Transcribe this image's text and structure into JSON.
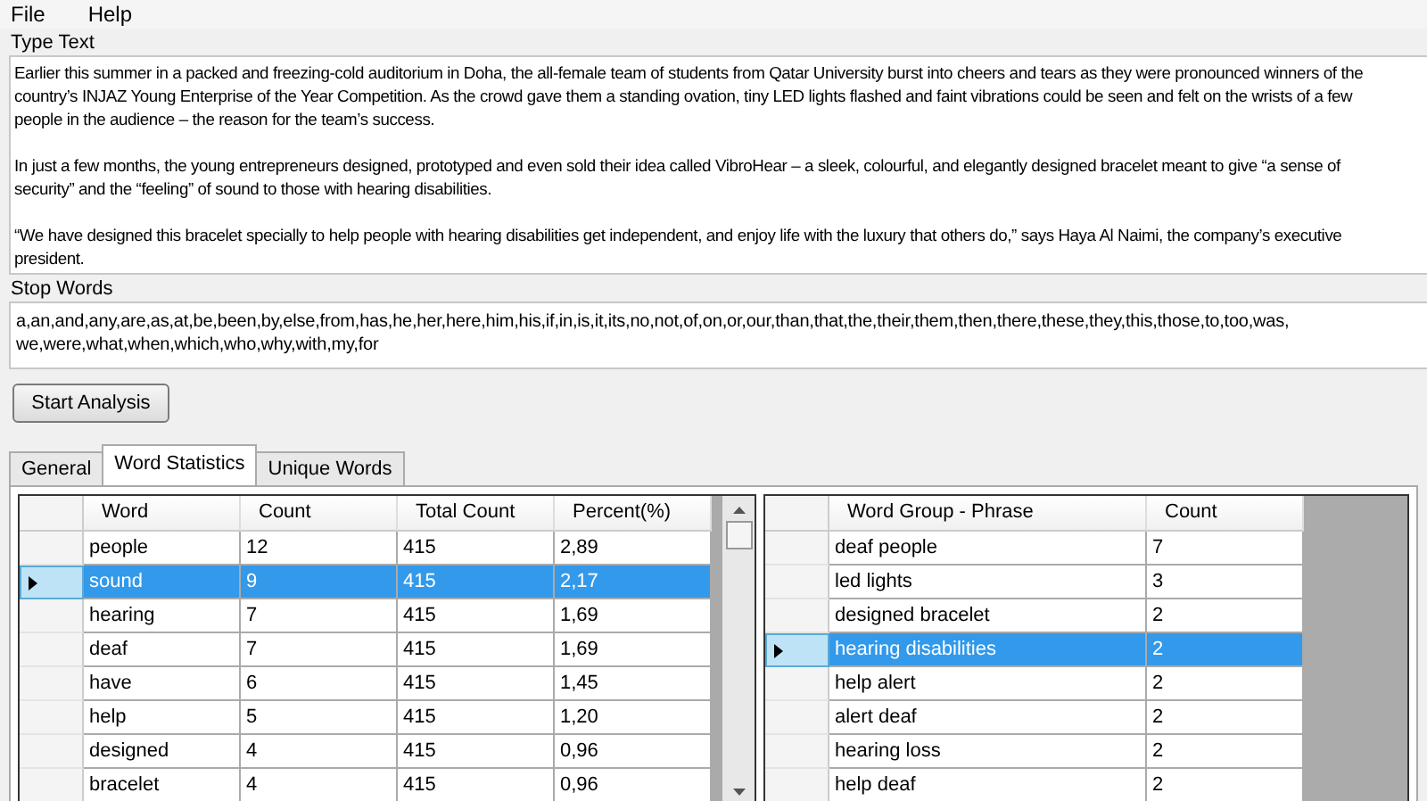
{
  "menu": [
    "File",
    "Help"
  ],
  "type_text": {
    "label": "Type Text",
    "paragraphs": [
      [
        "Earlier this summer in a packed and freezing-cold auditorium in Doha, the all-female team of students from Qatar University burst into cheers and tears as they were pronounced winners of the",
        "country’s INJAZ Young Enterprise of the Year Competition. As the crowd gave them a standing ovation, tiny LED lights flashed and faint vibrations could be seen and felt on the wrists of a few",
        "people in the audience – the reason for the team’s success."
      ],
      [
        "In just a few months, the young entrepreneurs designed, prototyped and even sold their idea called VibroHear – a sleek, colourful, and elegantly designed bracelet meant to give “a sense of",
        "security” and the “feeling” of sound to those with hearing disabilities."
      ],
      [
        "“We have designed this bracelet specially to help people with hearing disabilities get independent, and enjoy life with the luxury that others do,” says Haya Al Naimi, the company’s executive",
        "president."
      ]
    ]
  },
  "stop_words": {
    "label": "Stop Words",
    "lines": [
      "a,an,and,any,are,as,at,be,been,by,else,from,has,he,her,here,him,his,if,in,is,it,its,no,not,of,on,or,our,than,that,the,their,them,then,there,these,they,this,those,to,too,was,",
      "we,were,what,when,which,who,why,with,my,for"
    ]
  },
  "start_button": "Start Analysis",
  "tabs": [
    {
      "label": "General",
      "selected": false
    },
    {
      "label": "Word Statistics",
      "selected": true
    },
    {
      "label": "Unique Words",
      "selected": false
    }
  ],
  "word_table": {
    "columns": [
      "Word",
      "Count",
      "Total Count",
      "Percent(%)"
    ],
    "rows": [
      {
        "cells": [
          "people",
          "12",
          "415",
          "2,89"
        ],
        "selected": false
      },
      {
        "cells": [
          "sound",
          "9",
          "415",
          "2,17"
        ],
        "selected": true
      },
      {
        "cells": [
          "hearing",
          "7",
          "415",
          "1,69"
        ],
        "selected": false
      },
      {
        "cells": [
          "deaf",
          "7",
          "415",
          "1,69"
        ],
        "selected": false
      },
      {
        "cells": [
          "have",
          "6",
          "415",
          "1,45"
        ],
        "selected": false
      },
      {
        "cells": [
          "help",
          "5",
          "415",
          "1,20"
        ],
        "selected": false
      },
      {
        "cells": [
          "designed",
          "4",
          "415",
          "0,96"
        ],
        "selected": false
      },
      {
        "cells": [
          "bracelet",
          "4",
          "415",
          "0,96"
        ],
        "selected": false
      }
    ]
  },
  "phrase_table": {
    "columns": [
      "Word Group - Phrase",
      "Count"
    ],
    "rows": [
      {
        "cells": [
          "deaf people",
          "7"
        ],
        "selected": false
      },
      {
        "cells": [
          "led lights",
          "3"
        ],
        "selected": false
      },
      {
        "cells": [
          "designed bracelet",
          "2"
        ],
        "selected": false
      },
      {
        "cells": [
          "hearing disabilities",
          "2"
        ],
        "selected": true
      },
      {
        "cells": [
          "help alert",
          "2"
        ],
        "selected": false
      },
      {
        "cells": [
          "alert deaf",
          "2"
        ],
        "selected": false
      },
      {
        "cells": [
          "hearing loss",
          "2"
        ],
        "selected": false
      },
      {
        "cells": [
          "help deaf",
          "2"
        ],
        "selected": false
      }
    ]
  }
}
